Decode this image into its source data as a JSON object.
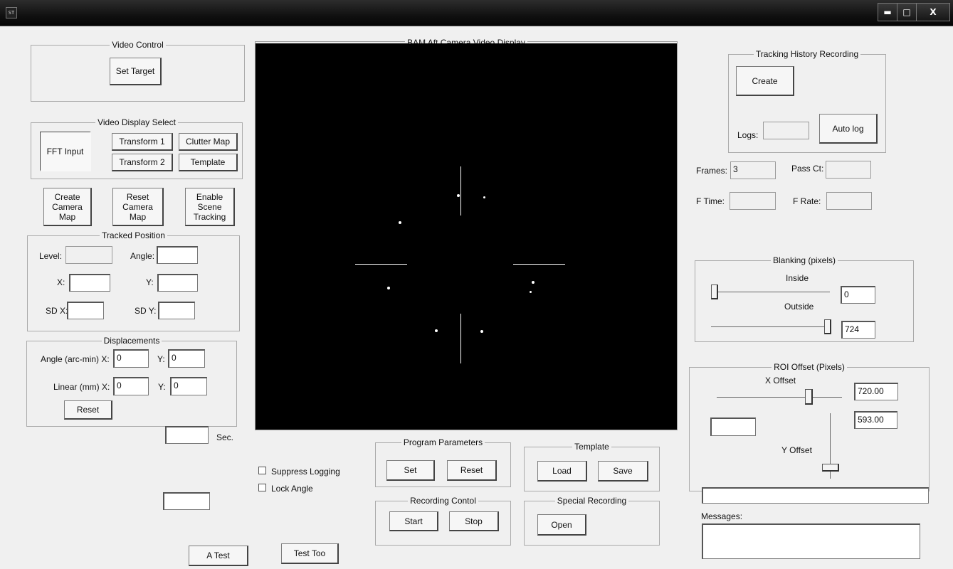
{
  "window": {
    "icon_text": "ST",
    "minimize": "▬",
    "maximize": "□",
    "close": "X"
  },
  "video_control": {
    "title": "Video Control",
    "set_target": "Set Target"
  },
  "video_display_select": {
    "title": "Video Display Select",
    "fft_input": "FFT Input",
    "transform1": "Transform 1",
    "clutter_map": "Clutter Map",
    "transform2": "Transform 2",
    "template": "Template"
  },
  "map_buttons": {
    "create_camera_map": "Create Camera Map",
    "reset_camera_map": "Reset Camera Map",
    "enable_scene_tracking": "Enable Scene Tracking"
  },
  "tracked_position": {
    "title": "Tracked Position",
    "level_label": "Level:",
    "level": "",
    "angle_label": "Angle:",
    "angle": "",
    "x_label": "X:",
    "x": "",
    "y_label": "Y:",
    "y": "",
    "sdx_label": "SD X:",
    "sdx": "",
    "sdy_label": "SD Y:",
    "sdy": ""
  },
  "displacements": {
    "title": "Displacements",
    "angle_label": "Angle (arc-min)  X:",
    "angle_x": "0",
    "angle_y_label": "Y:",
    "angle_y": "0",
    "linear_label": "Linear (mm)  X:",
    "linear_x": "0",
    "linear_y_label": "Y:",
    "linear_y": "0",
    "reset": "Reset"
  },
  "sec_field": {
    "value": "",
    "unit": "Sec."
  },
  "misc_field": "",
  "test_buttons": {
    "a_test": "A Test",
    "test_too": "Test Too"
  },
  "video_display": {
    "title": "BAM Aft Camera Video Display"
  },
  "checkboxes": {
    "suppress_logging": "Suppress Logging",
    "lock_angle": "Lock Angle"
  },
  "program_parameters": {
    "title": "Program Parameters",
    "set": "Set",
    "reset": "Reset"
  },
  "template_group": {
    "title": "Template",
    "load": "Load",
    "save": "Save"
  },
  "recording_control": {
    "title": "Recording Contol",
    "start": "Start",
    "stop": "Stop"
  },
  "special_recording": {
    "title": "Special Recording",
    "open": "Open"
  },
  "tracking_history": {
    "title": "Tracking History Recording",
    "create": "Create",
    "logs_label": "Logs:",
    "logs": "",
    "auto_log": "Auto log"
  },
  "stats": {
    "frames_label": "Frames:",
    "frames": "3",
    "pass_ct_label": "Pass Ct:",
    "pass_ct": "",
    "f_time_label": "F Time:",
    "f_time": "",
    "f_rate_label": "F Rate:",
    "f_rate": ""
  },
  "blanking": {
    "title": "Blanking (pixels)",
    "inside_label": "Inside",
    "inside": "0",
    "outside_label": "Outside",
    "outside": "724"
  },
  "roi_offset": {
    "title": "ROI Offset (Pixels)",
    "x_offset_label": "X Offset",
    "x_offset": "720.00",
    "y_offset_label": "Y Offset",
    "y_offset": "593.00",
    "extra": ""
  },
  "status_line": "",
  "messages": {
    "label": "Messages:",
    "text": ""
  }
}
